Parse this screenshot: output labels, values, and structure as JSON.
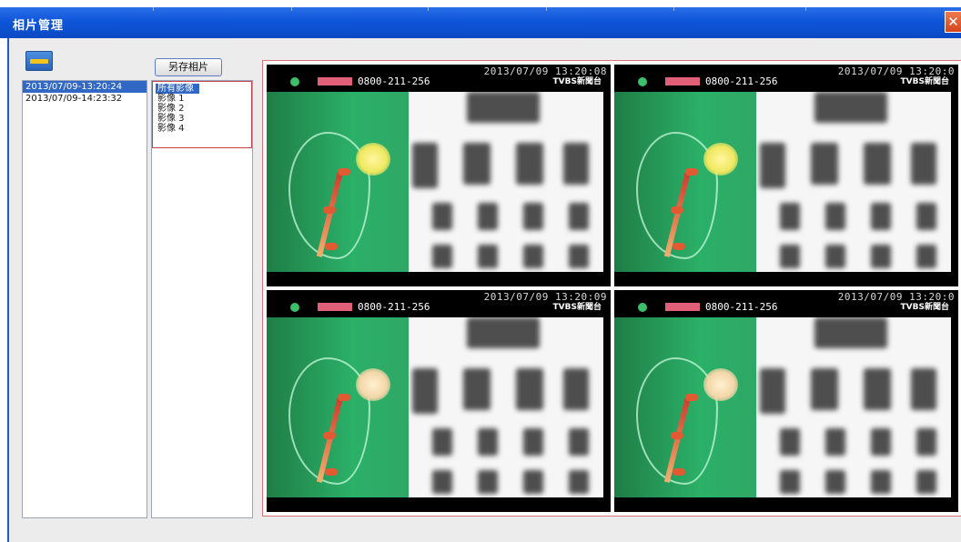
{
  "window": {
    "title": "相片管理",
    "close_glyph": "✕"
  },
  "toolbar": {
    "folder_icon": "folder-icon",
    "save_label": "另存相片"
  },
  "date_list": {
    "items": [
      "2013/07/09-13:20:24",
      "2013/07/09-14:23:32"
    ],
    "selected_index": 0
  },
  "image_list": {
    "items": [
      "所有影像",
      "影像 1",
      "影像 2",
      "影像 3",
      "影像 4"
    ],
    "selected_index": 0
  },
  "preview": {
    "frames": [
      {
        "timestamp": "2013/07/09  13:20:08",
        "phone": "0800-211-256",
        "channel": "TVBS新聞台"
      },
      {
        "timestamp": "2013/07/09  13:20:0",
        "phone": "0800-211-256",
        "channel": "TVBS新聞台"
      },
      {
        "timestamp": "2013/07/09  13:20:09",
        "phone": "0800-211-256",
        "channel": "TVBS新聞台"
      },
      {
        "timestamp": "2013/07/09  13:20:0",
        "phone": "0800-211-256",
        "channel": "TVBS新聞台"
      }
    ]
  },
  "colors": {
    "titlebar": "#0f55d9",
    "selection": "#3168c6",
    "highlight_border": "#c8444c",
    "preview_green": "#2bb068"
  }
}
